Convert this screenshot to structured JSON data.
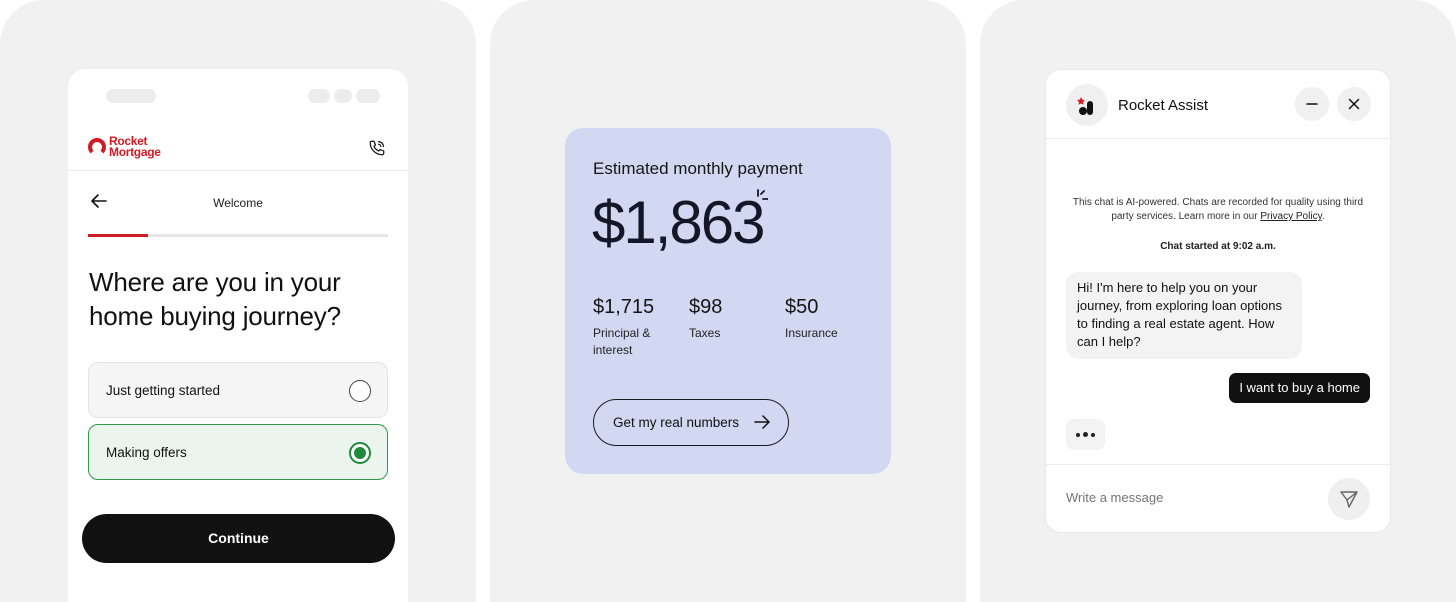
{
  "mortgage_app": {
    "logo_line1": "Rocket",
    "logo_line2": "Mortgage",
    "phone_icon": "phone-icon",
    "back_icon": "arrow-left-icon",
    "nav_title": "Welcome",
    "progress_fraction": 0.2,
    "question": "Where are you in your home buying journey?",
    "options": [
      {
        "label": "Just getting started",
        "selected": false
      },
      {
        "label": "Making offers",
        "selected": true
      }
    ],
    "continue_label": "Continue",
    "accent_color": "#d01a24",
    "selected_color": "#1e8a3a"
  },
  "payment_card": {
    "label": "Estimated monthly payment",
    "amount": "$1,863",
    "breakdown": [
      {
        "value": "$1,715",
        "label": "Principal & interest"
      },
      {
        "value": "$98",
        "label": "Taxes"
      },
      {
        "value": "$50",
        "label": "Insurance"
      }
    ],
    "cta_label": "Get my real numbers",
    "cta_icon": "arrow-right-icon",
    "background_color": "#d2d8f2"
  },
  "chat": {
    "title": "Rocket Assist",
    "minimize_icon": "minimize-icon",
    "close_icon": "close-icon",
    "disclaimer_text": "This chat is AI-powered. Chats are recorded for quality using third party services. Learn more in our ",
    "privacy_link": "Privacy Policy",
    "disclaimer_end": ".",
    "started_text": "Chat started at 9:02 a.m.",
    "bot_message": "Hi! I'm here to help you on your journey, from exploring loan options to finding a real estate agent. How can I help?",
    "user_message": "I want to buy a home",
    "input_placeholder": "Write a message",
    "send_icon": "send-icon"
  }
}
